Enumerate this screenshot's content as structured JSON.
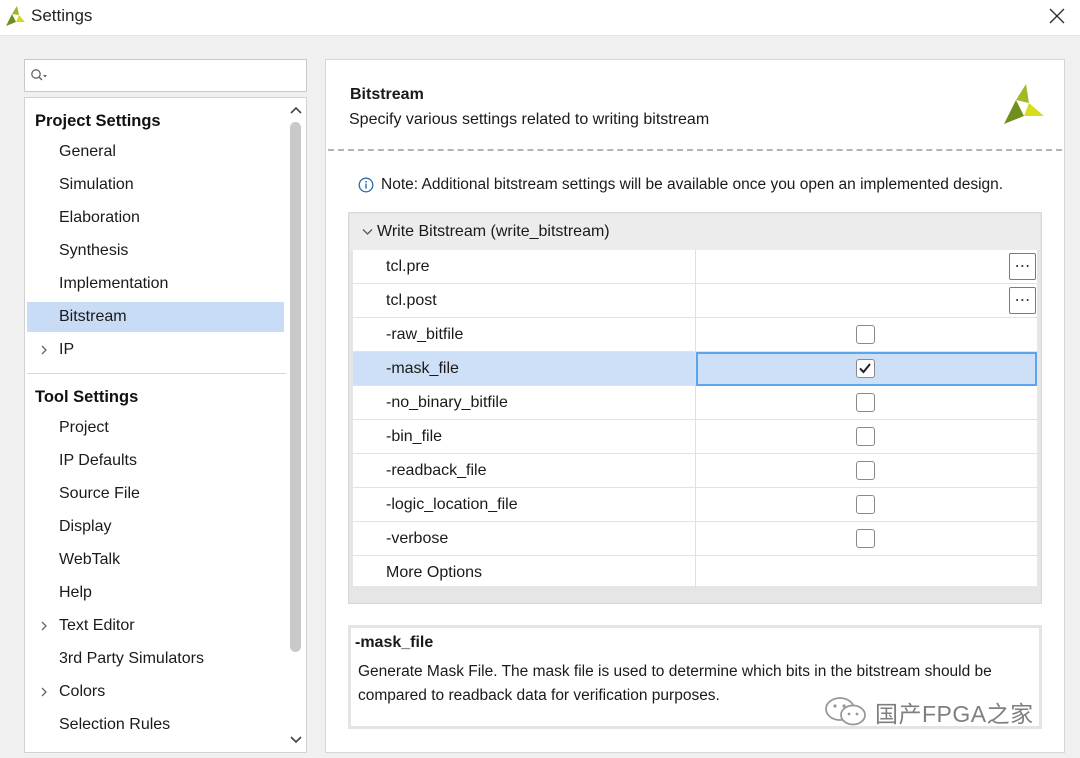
{
  "window": {
    "title": "Settings",
    "app_icon": "vivado-logo-icon",
    "close_icon": "close-icon"
  },
  "search": {
    "value": "",
    "placeholder": "",
    "icon": "search-icon"
  },
  "sidebar": {
    "project_settings_title": "Project Settings",
    "project_items": [
      {
        "label": "General",
        "expandable": false
      },
      {
        "label": "Simulation",
        "expandable": false
      },
      {
        "label": "Elaboration",
        "expandable": false
      },
      {
        "label": "Synthesis",
        "expandable": false
      },
      {
        "label": "Implementation",
        "expandable": false
      },
      {
        "label": "Bitstream",
        "expandable": false,
        "selected": true
      },
      {
        "label": "IP",
        "expandable": true
      }
    ],
    "tool_settings_title": "Tool Settings",
    "tool_items": [
      {
        "label": "Project",
        "expandable": false
      },
      {
        "label": "IP Defaults",
        "expandable": false
      },
      {
        "label": "Source File",
        "expandable": false
      },
      {
        "label": "Display",
        "expandable": false
      },
      {
        "label": "WebTalk",
        "expandable": false
      },
      {
        "label": "Help",
        "expandable": false
      },
      {
        "label": "Text Editor",
        "expandable": true
      },
      {
        "label": "3rd Party Simulators",
        "expandable": false
      },
      {
        "label": "Colors",
        "expandable": true
      },
      {
        "label": "Selection Rules",
        "expandable": false
      }
    ]
  },
  "main": {
    "title": "Bitstream",
    "description": "Specify various settings related to writing bitstream",
    "note": "Note: Additional bitstream settings will be available once you open an implemented design.",
    "group_label": "Write Bitstream (write_bitstream)",
    "options": [
      {
        "name": "tcl.pre",
        "type": "browse",
        "browse_label": "⋯"
      },
      {
        "name": "tcl.post",
        "type": "browse",
        "browse_label": "⋯"
      },
      {
        "name": "-raw_bitfile",
        "type": "checkbox",
        "checked": false
      },
      {
        "name": "-mask_file",
        "type": "checkbox",
        "checked": true,
        "selected": true
      },
      {
        "name": "-no_binary_bitfile",
        "type": "checkbox",
        "checked": false
      },
      {
        "name": "-bin_file",
        "type": "checkbox",
        "checked": false
      },
      {
        "name": "-readback_file",
        "type": "checkbox",
        "checked": false
      },
      {
        "name": "-logic_location_file",
        "type": "checkbox",
        "checked": false
      },
      {
        "name": "-verbose",
        "type": "checkbox",
        "checked": false
      },
      {
        "name": "More Options",
        "type": "text",
        "value": ""
      }
    ],
    "detail_title": "-mask_file",
    "detail_description": "Generate Mask File.  The mask file is used to determine which bits in the bitstream should be compared to readback data for verification purposes."
  },
  "watermark": {
    "text": "国产FPGA之家",
    "icon": "wechat-icon"
  },
  "colors": {
    "selection": "#c8dcf5",
    "selected_cell_border": "#5da5ea",
    "logo_green": "#7a9a1a",
    "logo_yellow": "#d8dc1a"
  }
}
